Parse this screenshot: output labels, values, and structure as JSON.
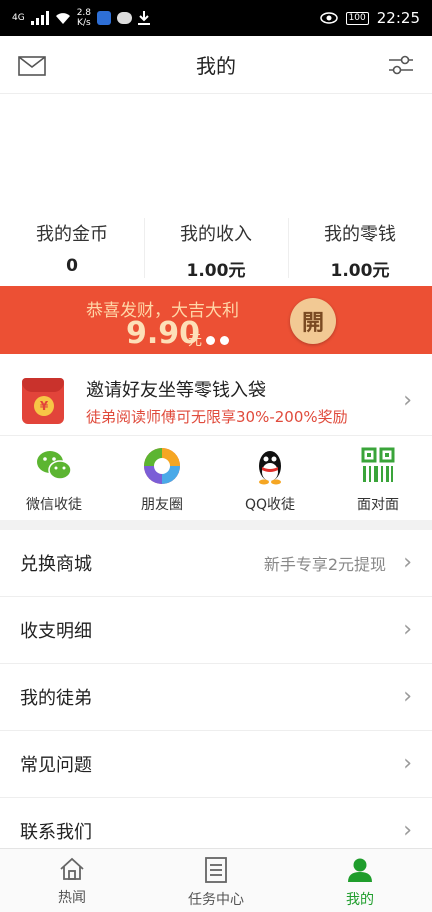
{
  "status_bar": {
    "network": "4G",
    "speed_value": "2.8",
    "speed_unit": "K/s",
    "battery": "100",
    "time": "22:25"
  },
  "header": {
    "title": "我的"
  },
  "stats": [
    {
      "label": "我的金币",
      "value": "0"
    },
    {
      "label": "我的收入",
      "value": "1.00元"
    },
    {
      "label": "我的零钱",
      "value": "1.00元"
    }
  ],
  "red_packet": {
    "title": "恭喜发财，大吉大利",
    "amount": "9.90",
    "unit": "元",
    "open_label": "開"
  },
  "invite": {
    "title": "邀请好友坐等零钱入袋",
    "subtitle": "徒弟阅读师傅可无限享30%-200%奖励",
    "yen": "¥"
  },
  "share_options": [
    {
      "label": "微信收徒",
      "icon": "wechat-icon"
    },
    {
      "label": "朋友圈",
      "icon": "moments-icon"
    },
    {
      "label": "QQ收徒",
      "icon": "qq-icon"
    },
    {
      "label": "面对面",
      "icon": "qrcode-icon"
    }
  ],
  "menu": [
    {
      "label": "兑换商城",
      "extra": "新手专享2元提现"
    },
    {
      "label": "收支明细",
      "extra": ""
    },
    {
      "label": "我的徒弟",
      "extra": ""
    },
    {
      "label": "常见问题",
      "extra": ""
    },
    {
      "label": "联系我们",
      "extra": ""
    }
  ],
  "tabs": [
    {
      "label": "热闻",
      "icon": "home-icon",
      "active": false
    },
    {
      "label": "任务中心",
      "icon": "task-list-icon",
      "active": false
    },
    {
      "label": "我的",
      "icon": "user-icon",
      "active": true
    }
  ],
  "colors": {
    "accent_green": "#1f9d2c",
    "red_banner": "#ec5034",
    "invite_red": "#e04b3c"
  }
}
